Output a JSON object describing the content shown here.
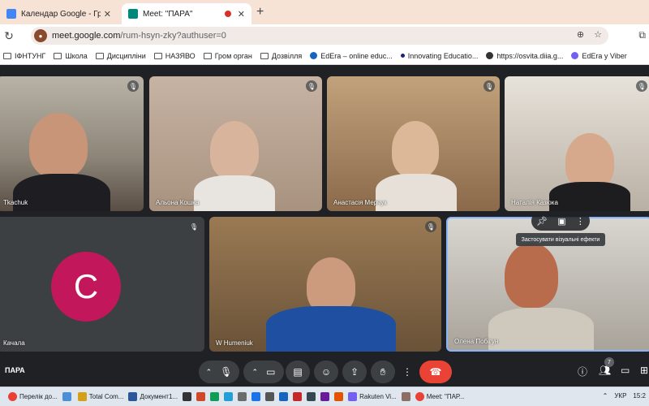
{
  "browser": {
    "tabs": [
      {
        "title": "Календар Google - Графік поч",
        "active": false
      },
      {
        "title": "Meet: \"ПАРА\"",
        "active": true
      }
    ],
    "url_host": "meet.google.com",
    "url_path": "/rum-hsyn-zky?authuser=0",
    "bookmarks": [
      "ІФНТУНГ",
      "Школа",
      "Дисципліни",
      "НАЗЯВО",
      "Гром орган",
      "Дозвілля",
      "EdEra – online educ...",
      "Innovating Educatio...",
      "https://osvita.diia.g...",
      "EdEra у Viber"
    ]
  },
  "meet": {
    "participants": [
      {
        "name": "Tkachuk"
      },
      {
        "name": "Альона Кошка"
      },
      {
        "name": "Анастасія Мерчук"
      },
      {
        "name": "Наталія Казюка"
      },
      {
        "name": "Качала",
        "avatar_letter": "C"
      },
      {
        "name": "W Humeniuk"
      },
      {
        "name": "Олена Побігун"
      }
    ],
    "tooltip": "Застосувати візуальні ефекти",
    "meeting_title": "ПАРА",
    "participant_count": "7",
    "colors": {
      "end_call": "#ea4335",
      "avatar": "#c2185b",
      "active_border": "#8ab4f8"
    }
  },
  "taskbar": {
    "items": [
      "Перелік до...",
      "Total Com...",
      "Документ1...",
      "Rakuten Vi...",
      "Meet: \"ПАР..."
    ],
    "lang": "УКР",
    "time": "15:2"
  }
}
